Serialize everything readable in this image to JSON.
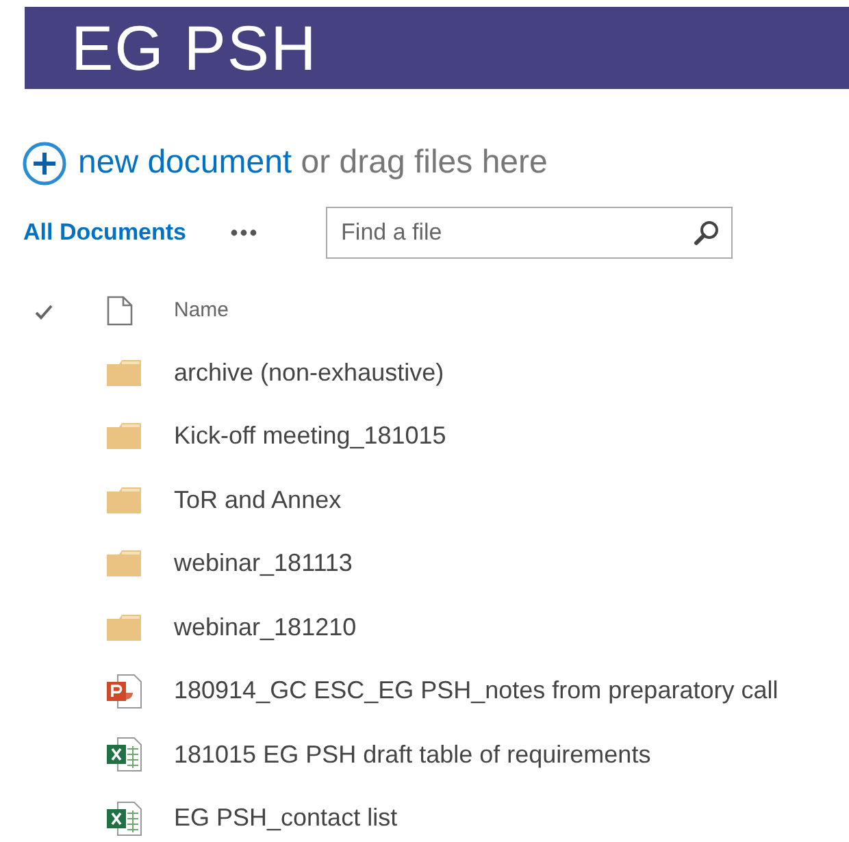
{
  "site": {
    "title": "EG PSH"
  },
  "upload": {
    "link": "new document",
    "text": " or drag files here"
  },
  "views": [
    {
      "label": "All Documents",
      "selected": true
    }
  ],
  "search": {
    "placeholder": "Find a file"
  },
  "table": {
    "columns": [
      {
        "label": "Name"
      }
    ],
    "rows": [
      {
        "kind": "folder",
        "name": "archive (non-exhaustive)"
      },
      {
        "kind": "folder",
        "name": "Kick-off meeting_181015"
      },
      {
        "kind": "folder",
        "name": "ToR and Annex"
      },
      {
        "kind": "folder",
        "name": "webinar_181113"
      },
      {
        "kind": "folder",
        "name": "webinar_181210"
      },
      {
        "kind": "presentation",
        "name": "180914_GC ESC_EG PSH_notes from preparatory call"
      },
      {
        "kind": "spreadsheet",
        "name": "181015 EG PSH draft table of requirements"
      },
      {
        "kind": "spreadsheet",
        "name": "EG PSH_contact list"
      }
    ]
  }
}
